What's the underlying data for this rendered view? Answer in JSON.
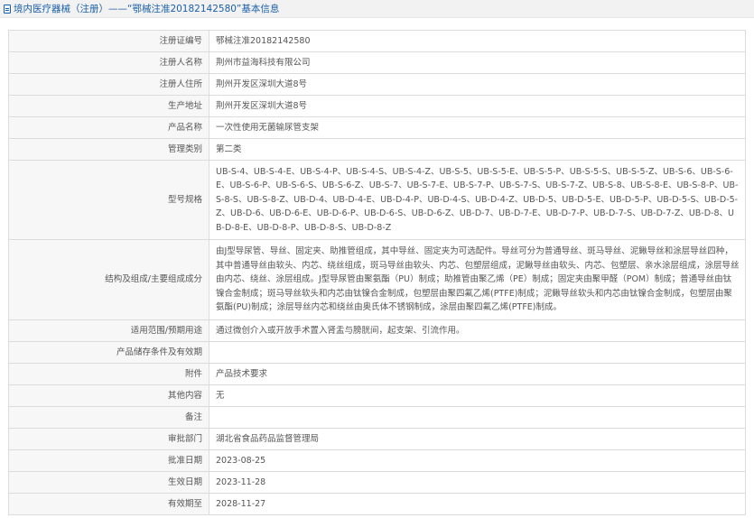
{
  "header": {
    "title": "境内医疗器械（注册）——“鄂械注准20182142580”基本信息"
  },
  "rows": [
    {
      "label": "注册证编号",
      "value": "鄂械注准20182142580"
    },
    {
      "label": "注册人名称",
      "value": "荆州市益海科技有限公司"
    },
    {
      "label": "注册人住所",
      "value": "荆州开发区深圳大道8号"
    },
    {
      "label": "生产地址",
      "value": "荆州开发区深圳大道8号"
    },
    {
      "label": "产品名称",
      "value": "一次性使用无菌输尿管支架"
    },
    {
      "label": "管理类别",
      "value": "第二类"
    },
    {
      "label": "型号规格",
      "value": "UB-S-4、UB-S-4-E、UB-S-4-P、UB-S-4-S、UB-S-4-Z、UB-S-5、UB-S-5-E、UB-S-5-P、UB-S-5-S、UB-S-5-Z、UB-S-6、UB-S-6-E、UB-S-6-P、UB-S-6-S、UB-S-6-Z、UB-S-7、UB-S-7-E、UB-S-7-P、UB-S-7-S、UB-S-7-Z、UB-S-8、UB-S-8-E、UB-S-8-P、UB-S-8-S、UB-S-8-Z、UB-D-4、UB-D-4-E、UB-D-4-P、UB-D-4-S、UB-D-4-Z、UB-D-5、UB-D-5-E、UB-D-5-P、UB-D-5-S、UB-D-5-Z、UB-D-6、UB-D-6-E、UB-D-6-P、UB-D-6-S、UB-D-6-Z、UB-D-7、UB-D-7-E、UB-D-7-P、UB-D-7-S、UB-D-7-Z、UB-D-8、UB-D-8-E、UB-D-8-P、UB-D-8-S、UB-D-8-Z"
    },
    {
      "label": "结构及组成/主要组成成分",
      "value": "由J型导尿管、导丝、固定夹、助推管组成，其中导丝、固定夹为可选配件。导丝可分为普通导丝、斑马导丝、泥鳅导丝和涂层导丝四种，其中普通导丝由软头、内芯、绕丝组成，斑马导丝由软头、内芯、包塑层组成，泥鳅导丝由软头、内芯、包塑层、亲水涂层组成，涂层导丝由内芯、绕丝、涂层组成。J型导尿管由聚氨酯（PU）制成；助推管由聚乙烯（PE）制成；固定夹由聚甲醛（POM）制成；普通导丝由钛镍合金制成；斑马导丝软头和内芯由钛镍合金制成，包塑层由聚四氟乙烯(PTFE)制成；泥鳅导丝软头和内芯由钛镍合金制成，包塑层由聚氨酯(PU)制成；涂层导丝内芯和绕丝由奥氏体不锈钢制成，涂层由聚四氟乙烯(PTFE)制成。"
    },
    {
      "label": "适用范围/预期用途",
      "value": "通过微创介入或开放手术置入肾盂与膀胱间，起支架、引流作用。"
    },
    {
      "label": "产品储存条件及有效期",
      "value": ""
    },
    {
      "label": "附件",
      "value": "产品技术要求"
    },
    {
      "label": "其他内容",
      "value": "无"
    },
    {
      "label": "备注",
      "value": ""
    },
    {
      "label": "审批部门",
      "value": "湖北省食品药品监督管理局"
    },
    {
      "label": "批准日期",
      "value": "2023-08-25"
    },
    {
      "label": "生效日期",
      "value": "2023-11-28"
    },
    {
      "label": "有效期至",
      "value": "2028-11-27"
    }
  ]
}
